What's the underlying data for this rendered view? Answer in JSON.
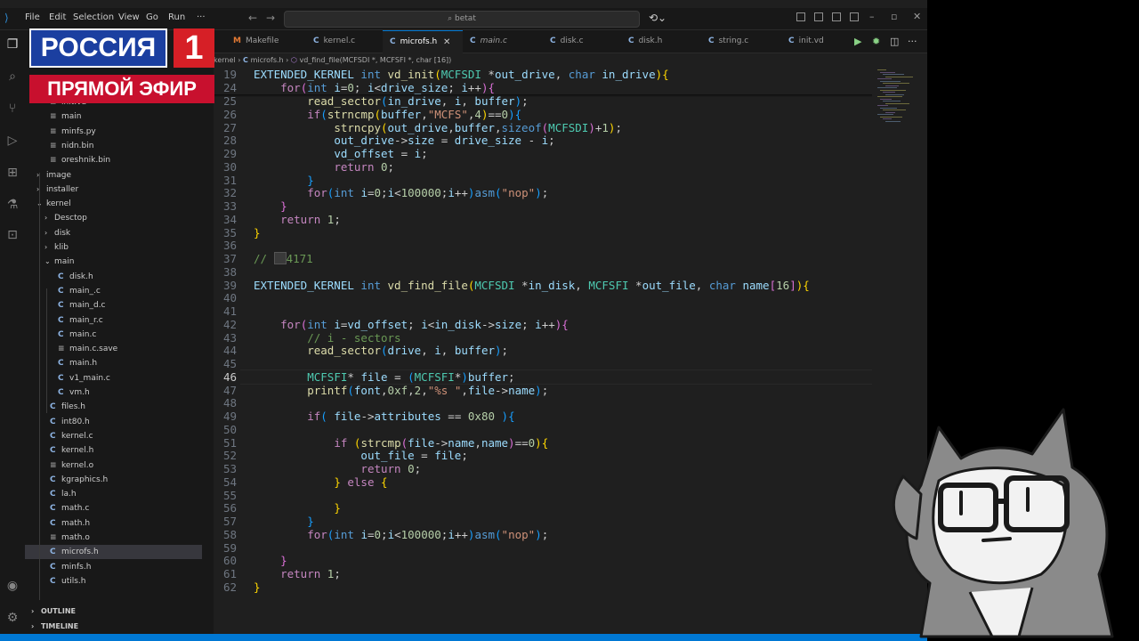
{
  "menu": [
    "File",
    "Edit",
    "Selection",
    "View",
    "Go",
    "Run",
    "···"
  ],
  "search": {
    "text": "betat"
  },
  "tabs": [
    {
      "icon": "M",
      "label": "Makefile"
    },
    {
      "icon": "C",
      "label": "kernel.c"
    },
    {
      "icon": "C",
      "label": "microfs.h",
      "active": true
    },
    {
      "icon": "C",
      "label": "main.c",
      "italic": true
    },
    {
      "icon": "C",
      "label": "disk.c"
    },
    {
      "icon": "C",
      "label": "disk.h"
    },
    {
      "icon": "C",
      "label": "string.c"
    },
    {
      "icon": "C",
      "label": "init.vd"
    }
  ],
  "breadcrumb": {
    "folder": "kernel",
    "file": "microfs.h",
    "symbol": "vd_find_file(MCFSDI *, MCFSFI *, char [16])"
  },
  "tree": [
    {
      "label": "init.vd",
      "icon": "",
      "indent": 1
    },
    {
      "label": "main",
      "icon": "",
      "indent": 1
    },
    {
      "label": "minfs.py",
      "icon": "",
      "indent": 1
    },
    {
      "label": "nidn.bin",
      "icon": "",
      "indent": 1
    },
    {
      "label": "oreshnik.bin",
      "icon": "",
      "indent": 1
    },
    {
      "label": "image",
      "chev": "›",
      "indent": 0
    },
    {
      "label": "installer",
      "chev": "›",
      "indent": 0
    },
    {
      "label": "kernel",
      "chev": "⌄",
      "indent": 0
    },
    {
      "label": "Desctop",
      "chev": "›",
      "indent": 1
    },
    {
      "label": "disk",
      "chev": "›",
      "indent": 1
    },
    {
      "label": "klib",
      "chev": "›",
      "indent": 1
    },
    {
      "label": "main",
      "chev": "⌄",
      "indent": 1
    },
    {
      "label": "disk.h",
      "icon": "C",
      "indent": 2
    },
    {
      "label": "main_.c",
      "icon": "C",
      "indent": 2
    },
    {
      "label": "main_d.c",
      "icon": "C",
      "indent": 2
    },
    {
      "label": "main_r.c",
      "icon": "C",
      "indent": 2
    },
    {
      "label": "main.c",
      "icon": "C",
      "indent": 2
    },
    {
      "label": "main.c.save",
      "icon": "",
      "indent": 2
    },
    {
      "label": "main.h",
      "icon": "C",
      "indent": 2
    },
    {
      "label": "v1_main.c",
      "icon": "C",
      "indent": 2
    },
    {
      "label": "vm.h",
      "icon": "C",
      "indent": 2
    },
    {
      "label": "files.h",
      "icon": "C",
      "indent": 1
    },
    {
      "label": "int80.h",
      "icon": "C",
      "indent": 1
    },
    {
      "label": "kernel.c",
      "icon": "C",
      "indent": 1
    },
    {
      "label": "kernel.h",
      "icon": "C",
      "indent": 1
    },
    {
      "label": "kernel.o",
      "icon": "",
      "indent": 1
    },
    {
      "label": "kgraphics.h",
      "icon": "C",
      "indent": 1
    },
    {
      "label": "la.h",
      "icon": "C",
      "indent": 1
    },
    {
      "label": "math.c",
      "icon": "C",
      "indent": 1
    },
    {
      "label": "math.h",
      "icon": "C",
      "indent": 1
    },
    {
      "label": "math.o",
      "icon": "",
      "indent": 1
    },
    {
      "label": "microfs.h",
      "icon": "C",
      "indent": 1,
      "selected": true
    },
    {
      "label": "minfs.h",
      "icon": "C",
      "indent": 1
    },
    {
      "label": "utils.h",
      "icon": "C",
      "indent": 1
    }
  ],
  "sections": {
    "outline": "OUTLINE",
    "timeline": "TIMELINE"
  },
  "sticky": [
    {
      "ln": "19",
      "html": "<span class=\"var\">EXTENDED_KERNEL</span> <span class=\"kw\">int</span> <span class=\"fn\">vd_init</span><span class=\"br1\">(</span><span class=\"ty\">MCFSDI</span> *<span class=\"var\">out_drive</span>, <span class=\"kw\">char</span> <span class=\"var\">in_drive</span><span class=\"br1\">)</span><span class=\"br1\">{</span>"
    },
    {
      "ln": "24",
      "html": "    <span class=\"ctl\">for</span><span class=\"br2\">(</span><span class=\"kw\">int</span> <span class=\"var\">i</span>=<span class=\"num\">0</span>; <span class=\"var\">i</span>&lt;<span class=\"var\">drive_size</span>; <span class=\"var\">i</span>++<span class=\"br2\">)</span><span class=\"br2\">{</span>"
    }
  ],
  "code": [
    {
      "ln": "25",
      "html": "        <span class=\"fn\">read_sector</span><span class=\"br3\">(</span><span class=\"var\">in_drive</span>, <span class=\"var\">i</span>, <span class=\"var\">buffer</span><span class=\"br3\">)</span>;"
    },
    {
      "ln": "26",
      "html": "        <span class=\"ctl\">if</span><span class=\"br3\">(</span><span class=\"fn\">strncmp</span><span class=\"br1\">(</span><span class=\"var\">buffer</span>,<span class=\"str\">\"MCFS\"</span>,<span class=\"num\">4</span><span class=\"br1\">)</span>==<span class=\"num\">0</span><span class=\"br3\">)</span><span class=\"br3\">{</span>"
    },
    {
      "ln": "27",
      "html": "            <span class=\"fn\">strncpy</span><span class=\"br1\">(</span><span class=\"var\">out_drive</span>,<span class=\"var\">buffer</span>,<span class=\"kw\">sizeof</span><span class=\"br2\">(</span><span class=\"ty\">MCFSDI</span><span class=\"br2\">)</span>+<span class=\"num\">1</span><span class=\"br1\">)</span>;"
    },
    {
      "ln": "28",
      "html": "            <span class=\"var\">out_drive</span>-&gt;<span class=\"var\">size</span> = <span class=\"var\">drive_size</span> - <span class=\"var\">i</span>;"
    },
    {
      "ln": "29",
      "html": "            <span class=\"var\">vd_offset</span> = <span class=\"var\">i</span>;"
    },
    {
      "ln": "30",
      "html": "            <span class=\"ctl\">return</span> <span class=\"num\">0</span>;"
    },
    {
      "ln": "31",
      "html": "        <span class=\"br3\">}</span>"
    },
    {
      "ln": "32",
      "html": "        <span class=\"ctl\">for</span><span class=\"br3\">(</span><span class=\"kw\">int</span> <span class=\"var\">i</span>=<span class=\"num\">0</span>;<span class=\"var\">i</span>&lt;<span class=\"num\">100000</span>;<span class=\"var\">i</span>++<span class=\"br3\">)</span><span class=\"kw\">asm</span><span class=\"br3\">(</span><span class=\"str\">\"nop\"</span><span class=\"br3\">)</span>;"
    },
    {
      "ln": "33",
      "html": "    <span class=\"br2\">}</span>"
    },
    {
      "ln": "34",
      "html": "    <span class=\"ctl\">return</span> <span class=\"num\">1</span>;"
    },
    {
      "ln": "35",
      "html": "<span class=\"br1\">}</span>"
    },
    {
      "ln": "36",
      "html": ""
    },
    {
      "ln": "37",
      "html": "<span class=\"cm\">// <span class=\"color-box\"></span>4171</span>"
    },
    {
      "ln": "38",
      "html": ""
    },
    {
      "ln": "39",
      "html": "<span class=\"var\">EXTENDED_KERNEL</span> <span class=\"kw\">int</span> <span class=\"fn\">vd_find_file</span><span class=\"br1\">(</span><span class=\"ty\">MCFSDI</span> *<span class=\"var\">in_disk</span>, <span class=\"ty\">MCFSFI</span> *<span class=\"var\">out_file</span>, <span class=\"kw\">char</span> <span class=\"var\">name</span><span class=\"br2\">[</span><span class=\"num\">16</span><span class=\"br2\">]</span><span class=\"br1\">)</span><span class=\"br1\">{</span>"
    },
    {
      "ln": "40",
      "html": ""
    },
    {
      "ln": "41",
      "html": ""
    },
    {
      "ln": "42",
      "html": "    <span class=\"ctl\">for</span><span class=\"br2\">(</span><span class=\"kw\">int</span> <span class=\"var\">i</span>=<span class=\"var\">vd_offset</span>; <span class=\"var\">i</span>&lt;<span class=\"var\">in_disk</span>-&gt;<span class=\"var\">size</span>; <span class=\"var\">i</span>++<span class=\"br2\">)</span><span class=\"br2\">{</span>"
    },
    {
      "ln": "43",
      "html": "        <span class=\"cm\">// i - sectors</span>"
    },
    {
      "ln": "44",
      "html": "        <span class=\"fn\">read_sector</span><span class=\"br3\">(</span><span class=\"var\">drive</span>, <span class=\"var\">i</span>, <span class=\"var\">buffer</span><span class=\"br3\">)</span>;"
    },
    {
      "ln": "45",
      "html": ""
    },
    {
      "ln": "46",
      "html": "        <span class=\"ty\">MCFSFI</span>* <span class=\"var\">file</span> = <span class=\"br3\">(</span><span class=\"ty\">MCFSFI</span>*<span class=\"br3\">)</span><span class=\"var\">buffer</span>;",
      "current": true
    },
    {
      "ln": "47",
      "html": "        <span class=\"fn\">printf</span><span class=\"br3\">(</span><span class=\"var\">font</span>,<span class=\"num\">0xf</span>,<span class=\"num\">2</span>,<span class=\"str\">\"%s \"</span>,<span class=\"var\">file</span>-&gt;<span class=\"var\">name</span><span class=\"br3\">)</span>;"
    },
    {
      "ln": "48",
      "html": ""
    },
    {
      "ln": "49",
      "html": "        <span class=\"ctl\">if</span><span class=\"br3\">(</span> <span class=\"var\">file</span>-&gt;<span class=\"var\">attributes</span> == <span class=\"num\">0x80</span> <span class=\"br3\">)</span><span class=\"br3\">{</span>"
    },
    {
      "ln": "50",
      "html": ""
    },
    {
      "ln": "51",
      "html": "            <span class=\"ctl\">if</span> <span class=\"br1\">(</span><span class=\"fn\">strcmp</span><span class=\"br2\">(</span><span class=\"var\">file</span>-&gt;<span class=\"var\">name</span>,<span class=\"var\">name</span><span class=\"br2\">)</span>==<span class=\"num\">0</span><span class=\"br1\">)</span><span class=\"br1\">{</span>"
    },
    {
      "ln": "52",
      "html": "                <span class=\"var\">out_file</span> = <span class=\"var\">file</span>;"
    },
    {
      "ln": "53",
      "html": "                <span class=\"ctl\">return</span> <span class=\"num\">0</span>;"
    },
    {
      "ln": "54",
      "html": "            <span class=\"br1\">}</span> <span class=\"ctl\">else</span> <span class=\"br1\">{</span>"
    },
    {
      "ln": "55",
      "html": ""
    },
    {
      "ln": "56",
      "html": "            <span class=\"br1\">}</span>"
    },
    {
      "ln": "57",
      "html": "        <span class=\"br3\">}</span>"
    },
    {
      "ln": "58",
      "html": "        <span class=\"ctl\">for</span><span class=\"br3\">(</span><span class=\"kw\">int</span> <span class=\"var\">i</span>=<span class=\"num\">0</span>;<span class=\"var\">i</span>&lt;<span class=\"num\">100000</span>;<span class=\"var\">i</span>++<span class=\"br3\">)</span><span class=\"kw\">asm</span><span class=\"br3\">(</span><span class=\"str\">\"nop\"</span><span class=\"br3\">)</span>;"
    },
    {
      "ln": "59",
      "html": ""
    },
    {
      "ln": "60",
      "html": "    <span class=\"br2\">}</span>"
    },
    {
      "ln": "61",
      "html": "    <span class=\"ctl\">return</span> <span class=\"num\">1</span>;"
    },
    {
      "ln": "62",
      "html": "<span class=\"br1\">}</span>"
    }
  ],
  "overlay": {
    "channel": "РОССИЯ",
    "channel_num": "1",
    "live": "ПРЯМОЙ ЭФИР"
  },
  "colors": {
    "accent": "#0078d4",
    "editor_bg": "#1f1f1f",
    "sidebar_bg": "#181818"
  }
}
